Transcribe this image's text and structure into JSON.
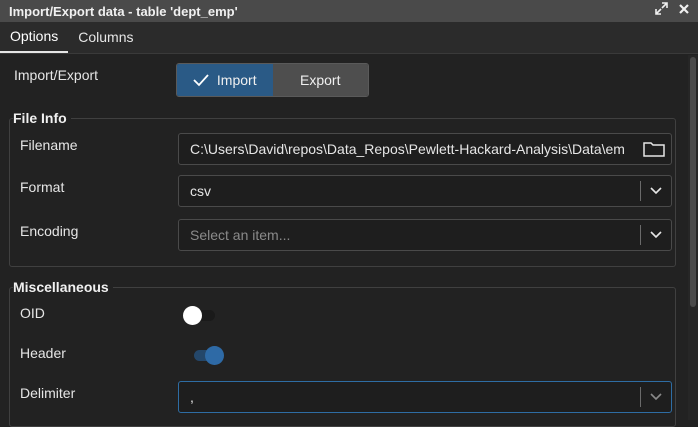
{
  "window": {
    "title": "Import/Export data - table 'dept_emp'"
  },
  "tabs": [
    {
      "label": "Options"
    },
    {
      "label": "Columns"
    }
  ],
  "import_export": {
    "label": "Import/Export",
    "import_label": "Import",
    "export_label": "Export",
    "selected": "Import"
  },
  "file_info": {
    "title": "File Info",
    "filename_label": "Filename",
    "filename_value": "C:\\Users\\David\\repos\\Data_Repos\\Pewlett-Hackard-Analysis\\Data\\em",
    "format_label": "Format",
    "format_value": "csv",
    "encoding_label": "Encoding",
    "encoding_placeholder": "Select an item..."
  },
  "misc": {
    "title": "Miscellaneous",
    "oid_label": "OID",
    "oid_on": false,
    "header_label": "Header",
    "header_on": true,
    "delimiter_label": "Delimiter",
    "delimiter_value": ","
  },
  "colors": {
    "accent": "#2a5a86",
    "focus_border": "#2e6da4",
    "titlebar": "#4a4a4a"
  }
}
